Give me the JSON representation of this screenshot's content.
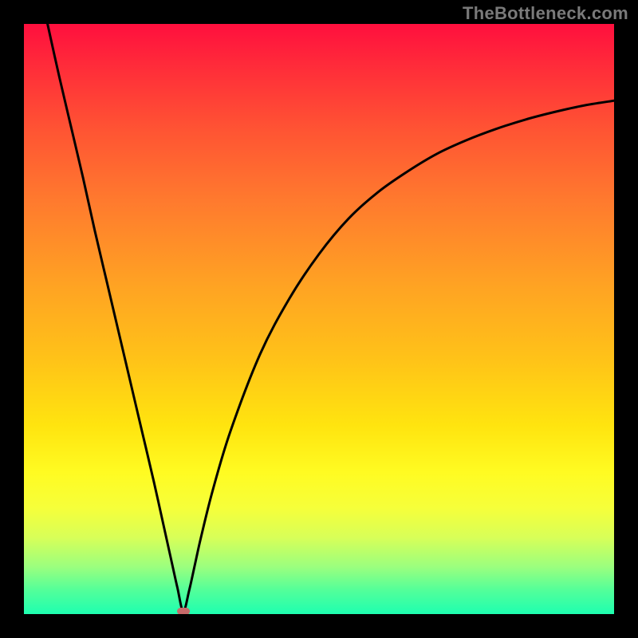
{
  "watermark": "TheBottleneck.com",
  "colors": {
    "frame": "#000000",
    "curve": "#000000",
    "marker": "#c76a6a",
    "gradient_top": "#ff0f3e",
    "gradient_bottom": "#1effb0",
    "watermark": "#7a7a7a"
  },
  "chart_data": {
    "type": "line",
    "title": "",
    "xlabel": "",
    "ylabel": "",
    "xlim": [
      0,
      100
    ],
    "ylim": [
      0,
      100
    ],
    "grid": false,
    "legend": false,
    "minimum_x": 27,
    "series": [
      {
        "name": "curve",
        "x": [
          4,
          6,
          8,
          10,
          12,
          14,
          16,
          18,
          20,
          22,
          24,
          25,
          26,
          27,
          28,
          29,
          30,
          32,
          35,
          40,
          45,
          50,
          55,
          60,
          65,
          70,
          75,
          80,
          85,
          90,
          95,
          100
        ],
        "y": [
          100,
          91,
          82.5,
          74,
          65,
          56.5,
          48,
          39.5,
          31,
          22.5,
          13.5,
          9,
          4.5,
          0.5,
          4,
          8.5,
          13,
          21,
          31,
          44,
          53.5,
          61,
          67,
          71.5,
          75,
          78,
          80.3,
          82.2,
          83.8,
          85.1,
          86.2,
          87
        ]
      }
    ],
    "marker": {
      "x": 27,
      "y": 0.5
    }
  }
}
